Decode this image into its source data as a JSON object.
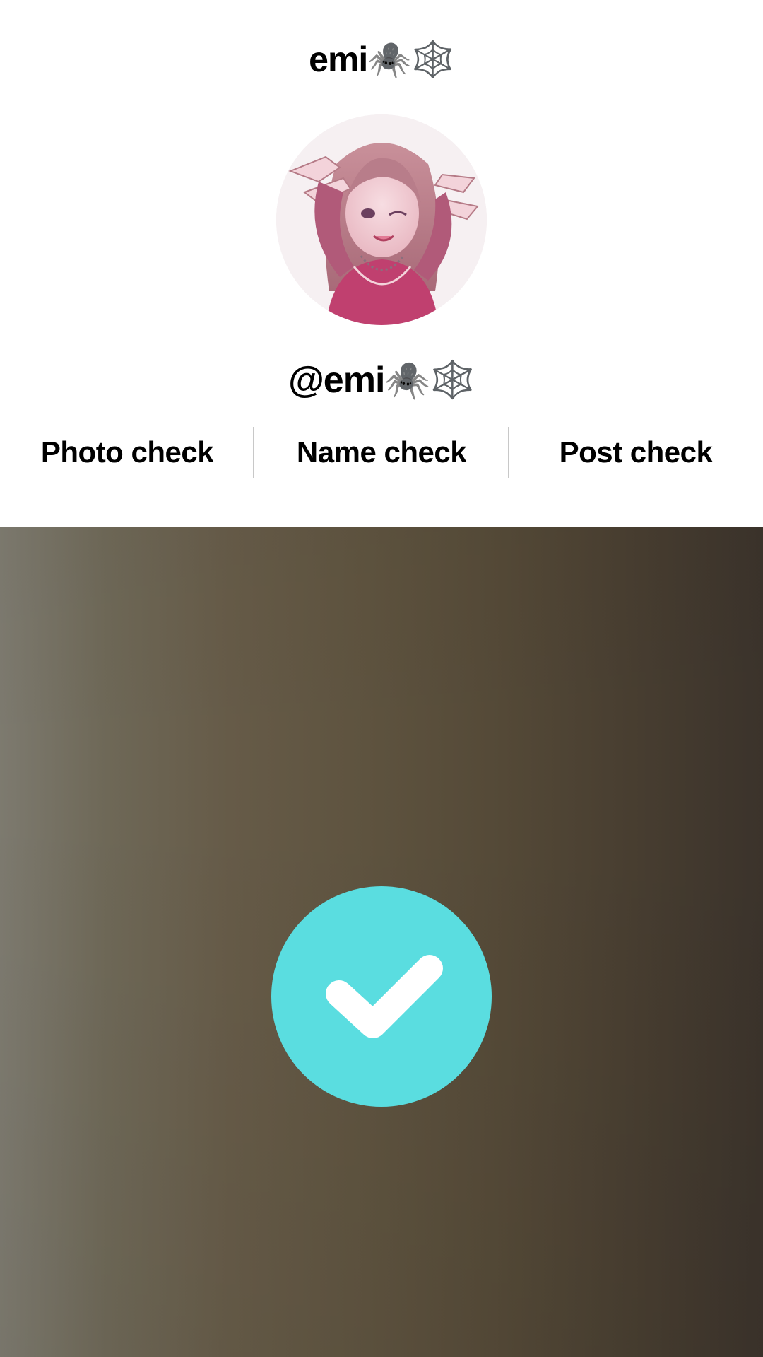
{
  "profile": {
    "display_name": "emi🕷️🕸️",
    "username": "@emi🕷️🕸️",
    "avatar_icon": "anime-girl-avatar"
  },
  "checks": {
    "photo_label": "Photo check",
    "name_label": "Name check",
    "post_label": "Post check"
  },
  "status": {
    "icon": "checkmark-icon",
    "badge_color": "#5adde0"
  },
  "colors": {
    "text": "#000000",
    "divider": "#c8c8c8",
    "video_bg_dark": "#3b332b",
    "video_bg_light": "#7d7a6f"
  }
}
